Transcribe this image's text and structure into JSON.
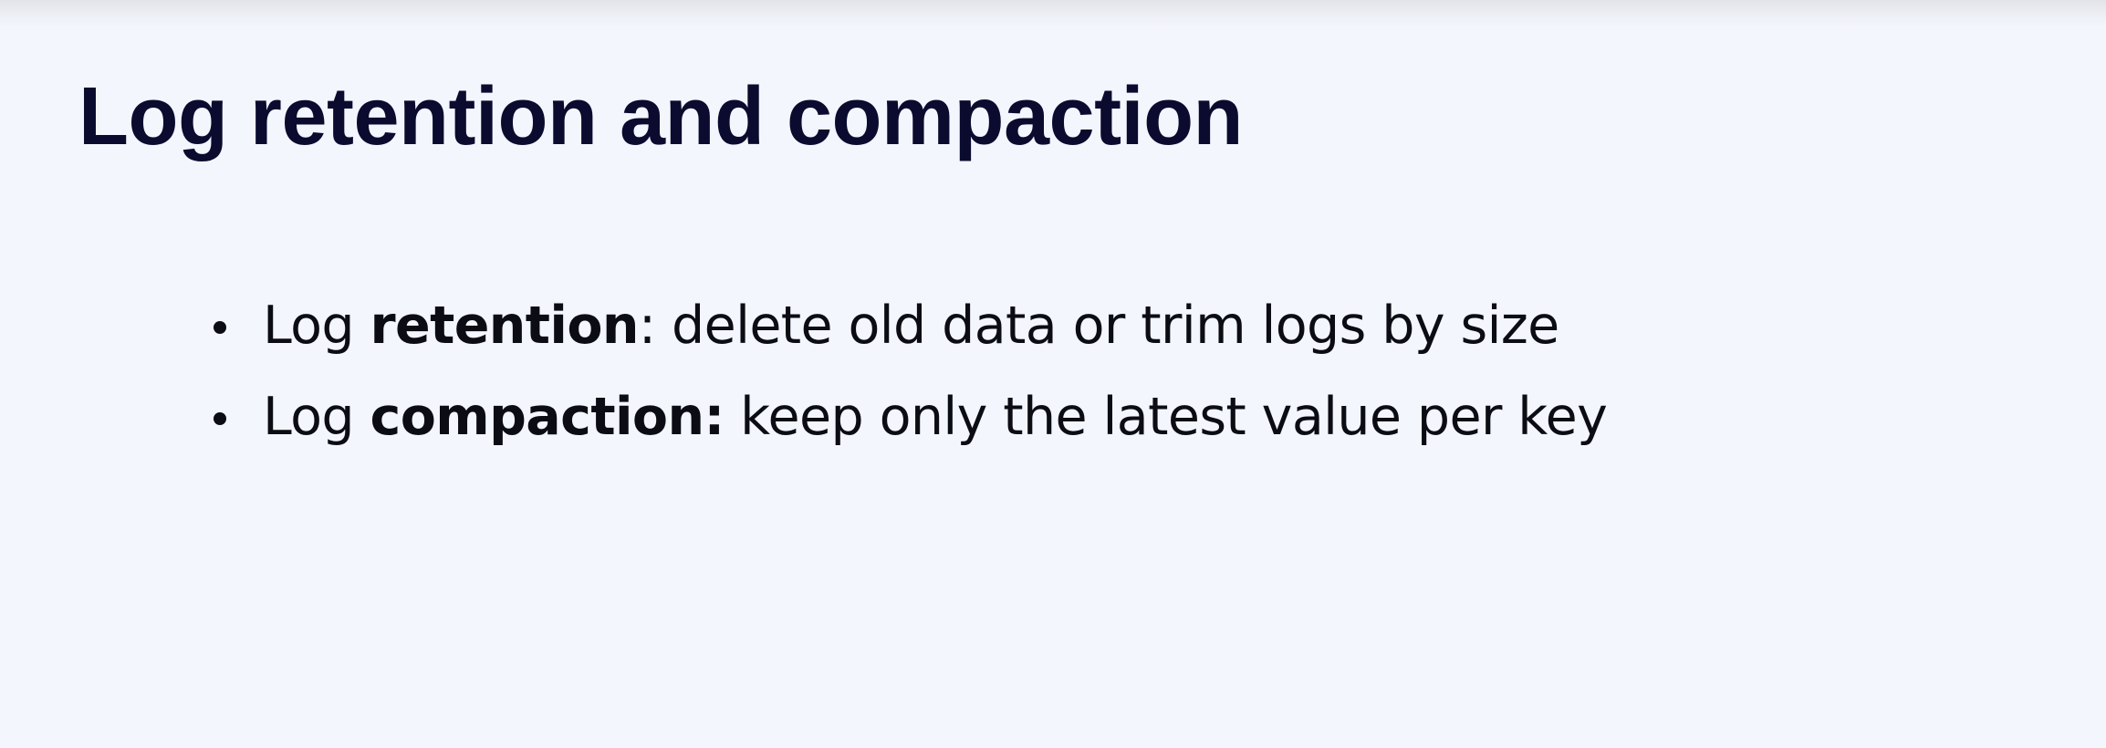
{
  "slide": {
    "title": "Log retention and compaction",
    "bullets": [
      {
        "prefix": "Log ",
        "term": "retention",
        "rest": ": delete old data or trim logs by size"
      },
      {
        "prefix": "Log ",
        "term": "compaction:",
        "rest": " keep only the latest value per key"
      }
    ]
  },
  "colors": {
    "background": "#f3f6fd",
    "title": "#0a0b2e",
    "body_text": "#0c0c14"
  }
}
